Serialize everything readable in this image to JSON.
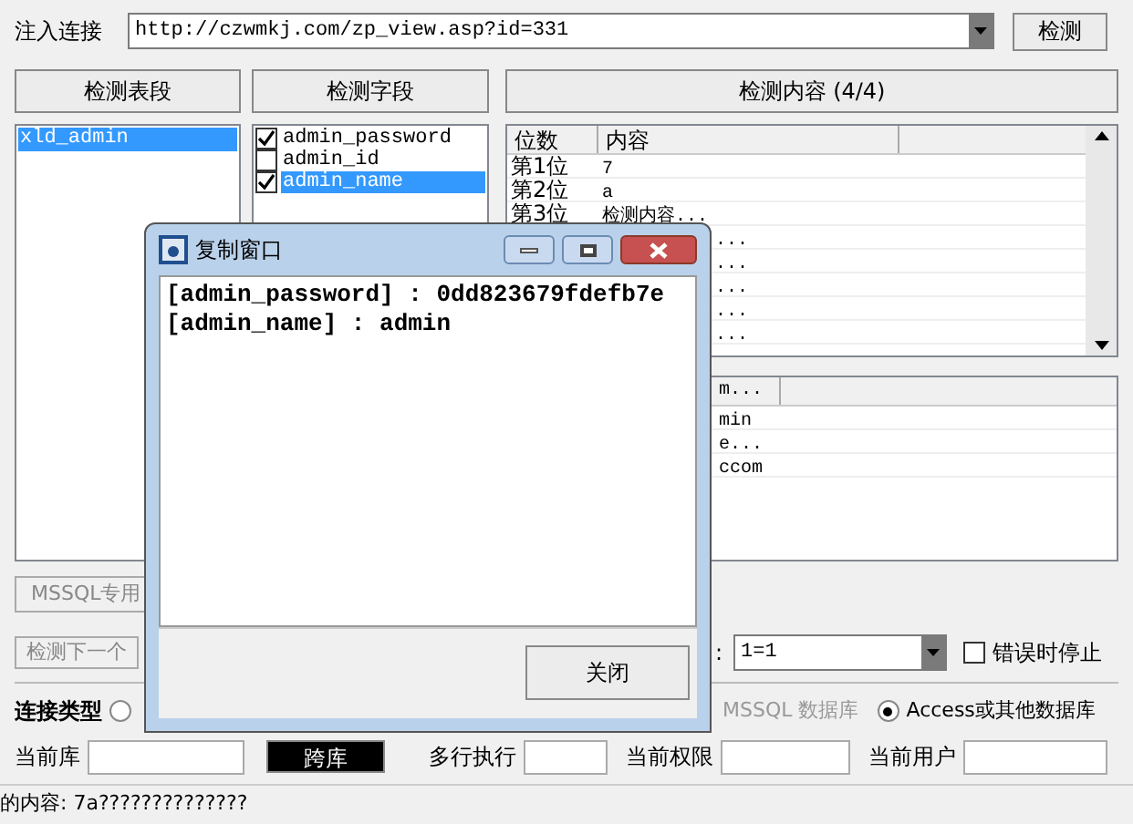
{
  "url_bar": {
    "label": "注入连接",
    "value": "http://czwmkj.com/zp_view.asp?id=331",
    "button": "检测"
  },
  "sections": [
    "检测表段",
    "检测字段",
    "检测内容 (4/4)"
  ],
  "tables": [
    {
      "label": "xld_admin",
      "selected": true
    }
  ],
  "fields": [
    {
      "label": "admin_password",
      "checked": true,
      "selected": false
    },
    {
      "label": "admin_id",
      "checked": false,
      "selected": false
    },
    {
      "label": "admin_name",
      "checked": true,
      "selected": true
    }
  ],
  "content_table": {
    "columns": [
      "位数",
      "内容"
    ],
    "rows": [
      {
        "position": "第1位",
        "content": "7"
      },
      {
        "position": "第2位",
        "content": "a"
      },
      {
        "position": "第3位",
        "content": "检测内容..."
      },
      {
        "content": "..."
      },
      {
        "content": "..."
      },
      {
        "content": "..."
      },
      {
        "content": "..."
      },
      {
        "content": "..."
      }
    ]
  },
  "results_table": {
    "column": "m...",
    "rows": [
      "min",
      "e...",
      "ccom"
    ]
  },
  "mssql_button": "MSSQL专用",
  "next_button": "检测下一个",
  "condition": {
    "label": ":",
    "value": "1=1"
  },
  "stop_on_error": {
    "label": "错误时停止",
    "checked": false
  },
  "connection": {
    "label": "连接类型",
    "options": [
      {
        "selected": false
      },
      {
        "label": "MSSQL 数据库",
        "disabled": true
      },
      {
        "label": "Access或其他数据库",
        "selected": true
      }
    ]
  },
  "info_row": [
    {
      "kind": "input",
      "label": "当前库"
    },
    {
      "kind": "button",
      "label": "跨库"
    },
    {
      "kind": "input",
      "label": "多行执行"
    },
    {
      "kind": "input",
      "label": "当前权限"
    },
    {
      "kind": "input",
      "label": "当前用户"
    }
  ],
  "status": "的内容: 7a??????????????",
  "dialog": {
    "title": "复制窗口",
    "lines": [
      "[admin_password] : 0dd823679fdefb7e",
      "[admin_name] : admin"
    ],
    "close_button": "关闭"
  }
}
